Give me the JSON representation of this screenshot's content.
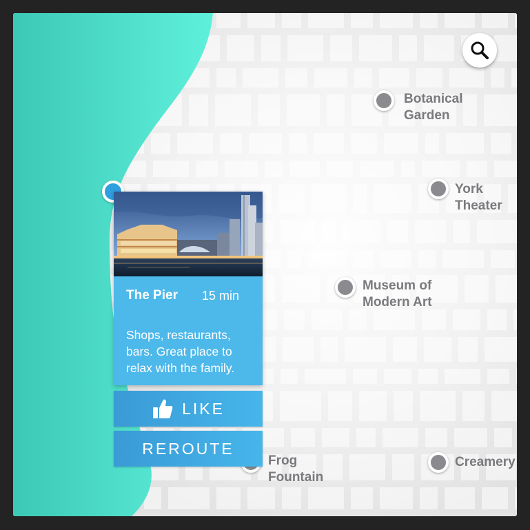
{
  "search": {
    "icon": "search-icon"
  },
  "pois": [
    {
      "name": "Botanical\nGarden",
      "icon": "map-pin-icon"
    },
    {
      "name": "York\nTheater",
      "icon": "map-pin-icon"
    },
    {
      "name": "Museum of\nModern Art",
      "icon": "map-pin-icon"
    },
    {
      "name": "Frog\nFountain",
      "icon": "map-pin-icon"
    },
    {
      "name": "Creamery",
      "icon": "map-pin-icon"
    }
  ],
  "selected_place": {
    "title": "The Pier",
    "travel_time": "15 min",
    "description": "Shops, restaurants, bars. Great place to relax with the family.",
    "photo_icon": "harbor-photo"
  },
  "actions": {
    "like_label": "LIKE",
    "like_icon": "thumbs-up-icon",
    "reroute_label": "REROUTE"
  },
  "colors": {
    "water": "#4fe3cf",
    "card": "#4db8ea",
    "button": "#3fa6df",
    "selected_pin": "#2f9fe0",
    "poi_pin": "#8b8b8f",
    "poi_label": "#7a7a7e",
    "frame": "#232323"
  }
}
